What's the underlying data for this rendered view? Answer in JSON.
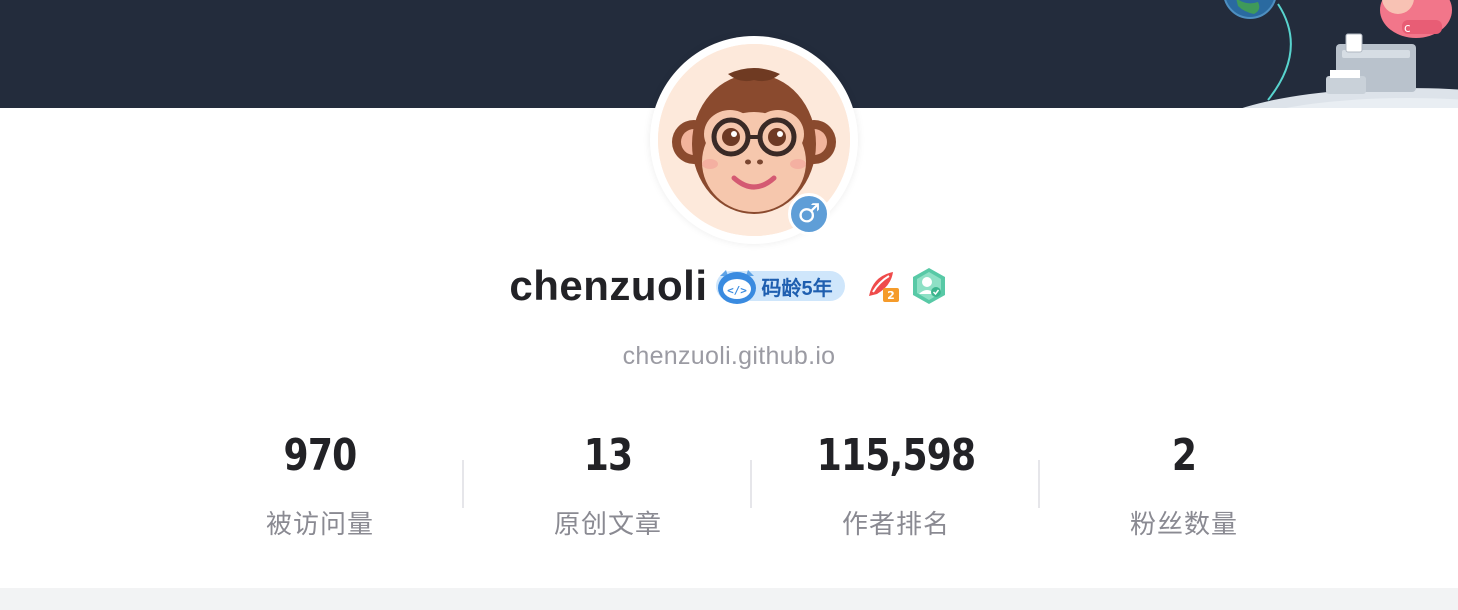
{
  "profile": {
    "username": "chenzuoli",
    "code_age_label": "码龄5年",
    "homepage": "chenzuoli.github.io",
    "gender_symbol": "♂"
  },
  "stats": [
    {
      "value": "970",
      "label": "被访问量"
    },
    {
      "value": "13",
      "label": "原创文章"
    },
    {
      "value": "115,598",
      "label": "作者排名"
    },
    {
      "value": "2",
      "label": "粉丝数量"
    }
  ],
  "colors": {
    "banner": "#232c3c",
    "name_text": "#222226",
    "muted_text": "#8a8a92",
    "code_age_bg": "#cfe6fb",
    "code_age_text": "#1f5fb0",
    "gender_badge": "#5f9ed7"
  },
  "icons": {
    "code_age": "code-age-icon",
    "blog_expert": "quill-badge-icon",
    "certified": "certified-user-icon",
    "gender": "male-icon"
  }
}
